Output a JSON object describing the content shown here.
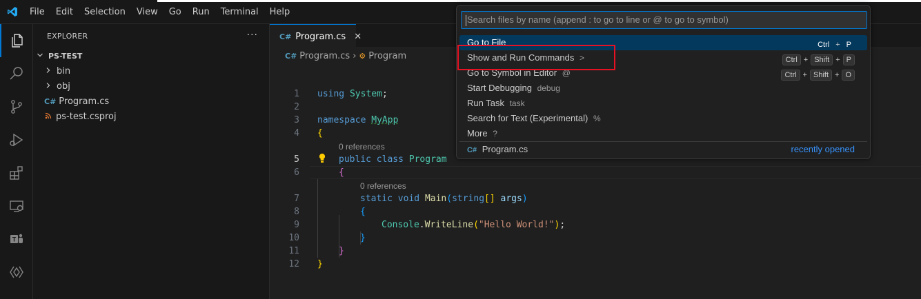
{
  "titlebar": {
    "menu": [
      "File",
      "Edit",
      "Selection",
      "View",
      "Go",
      "Run",
      "Terminal",
      "Help"
    ]
  },
  "activitybar": {
    "icons": [
      "explorer-icon",
      "search-icon",
      "source-control-icon",
      "run-debug-icon",
      "extensions-icon",
      "remote-explorer-icon",
      "teams-icon",
      "copilot-icon"
    ]
  },
  "sidebar": {
    "title": "EXPLORER",
    "more": "···",
    "root": "PS-TEST",
    "items": [
      {
        "label": "bin",
        "type": "folder"
      },
      {
        "label": "obj",
        "type": "folder"
      },
      {
        "label": "Program.cs",
        "type": "cs"
      },
      {
        "label": "ps-test.csproj",
        "type": "rss"
      }
    ]
  },
  "editor": {
    "tab": {
      "label": "Program.cs",
      "close": "✕"
    },
    "breadcrumb": {
      "file": "Program.cs",
      "separator": "›",
      "symbol": "Program"
    },
    "lens": {
      "line5": "0 references",
      "line7": "0 references"
    },
    "line_numbers": [
      "1",
      "2",
      "3",
      "4",
      "5",
      "6",
      "7",
      "8",
      "9",
      "10",
      "11",
      "12"
    ],
    "current_line": 5
  },
  "quickopen": {
    "placeholder": "Search files by name (append : to go to line or @ to go to symbol)",
    "items": [
      {
        "label": "Go to File",
        "hint": "",
        "keys": [
          "Ctrl",
          "+",
          "P"
        ],
        "selected": true
      },
      {
        "label": "Show and Run Commands",
        "hint": ">",
        "keys": [
          "Ctrl",
          "+",
          "Shift",
          "+",
          "P"
        ]
      },
      {
        "label": "Go to Symbol in Editor",
        "hint": "@",
        "keys": [
          "Ctrl",
          "+",
          "Shift",
          "+",
          "O"
        ]
      },
      {
        "label": "Start Debugging",
        "hint": "debug",
        "keys": []
      },
      {
        "label": "Run Task",
        "hint": "task",
        "keys": []
      },
      {
        "label": "Search for Text (Experimental)",
        "hint": "%",
        "keys": []
      },
      {
        "label": "More",
        "hint": "?",
        "keys": []
      }
    ],
    "recent": {
      "file": "Program.cs",
      "label": "recently opened"
    }
  },
  "colors": {
    "accent": "#0078d4",
    "highlight_box": "#e81123",
    "selection": "#04395e"
  }
}
